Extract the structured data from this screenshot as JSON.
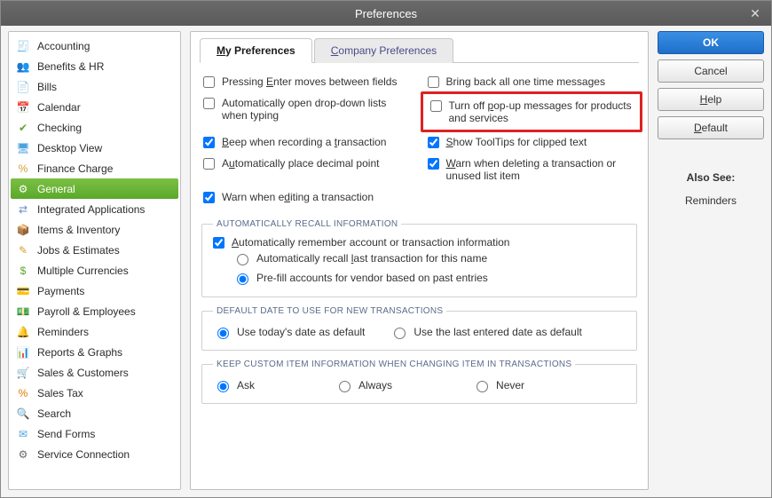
{
  "window": {
    "title": "Preferences"
  },
  "sidebar": {
    "items": [
      {
        "label": "Accounting",
        "icon": "🧾",
        "color": "#d0a030"
      },
      {
        "label": "Benefits & HR",
        "icon": "👥",
        "color": "#4aa3df"
      },
      {
        "label": "Bills",
        "icon": "📄",
        "color": "#5aa82b"
      },
      {
        "label": "Calendar",
        "icon": "📅",
        "color": "#d0a030"
      },
      {
        "label": "Checking",
        "icon": "✔",
        "color": "#5aa82b"
      },
      {
        "label": "Desktop View",
        "icon": "🖥",
        "color": "#4aa3df"
      },
      {
        "label": "Finance Charge",
        "icon": "%",
        "color": "#d0a030"
      },
      {
        "label": "General",
        "icon": "⚙",
        "color": "#ffffff",
        "selected": true
      },
      {
        "label": "Integrated Applications",
        "icon": "⇄",
        "color": "#6a8ac0"
      },
      {
        "label": "Items & Inventory",
        "icon": "📦",
        "color": "#d0a030"
      },
      {
        "label": "Jobs & Estimates",
        "icon": "✎",
        "color": "#d0a030"
      },
      {
        "label": "Multiple Currencies",
        "icon": "$",
        "color": "#5aa82b"
      },
      {
        "label": "Payments",
        "icon": "💳",
        "color": "#4aa3df"
      },
      {
        "label": "Payroll & Employees",
        "icon": "💵",
        "color": "#5aa82b"
      },
      {
        "label": "Reminders",
        "icon": "🔔",
        "color": "#d0a030"
      },
      {
        "label": "Reports & Graphs",
        "icon": "📊",
        "color": "#c0504d"
      },
      {
        "label": "Sales & Customers",
        "icon": "🛒",
        "color": "#d0a030"
      },
      {
        "label": "Sales Tax",
        "icon": "%",
        "color": "#e07b00"
      },
      {
        "label": "Search",
        "icon": "🔍",
        "color": "#6a6a6a"
      },
      {
        "label": "Send Forms",
        "icon": "✉",
        "color": "#4aa3df"
      },
      {
        "label": "Service Connection",
        "icon": "⚙",
        "color": "#6a6a6a"
      }
    ]
  },
  "tabs": {
    "my": "My Preferences",
    "company": "Company Preferences"
  },
  "options": {
    "left": [
      {
        "key": "enter_moves",
        "checked": false,
        "html": "Pressing <u>E</u>nter moves between fields"
      },
      {
        "key": "auto_dropdown",
        "checked": false,
        "html": "Automatically open drop-down lists when typing"
      },
      {
        "key": "beep",
        "checked": true,
        "html": "<u>B</u>eep when recording a <u>t</u>ransaction"
      },
      {
        "key": "auto_decimal",
        "checked": false,
        "html": "A<u>u</u>tomatically place decimal point"
      },
      {
        "key": "warn_edit",
        "checked": true,
        "html": "Warn when e<u>d</u>iting a transaction"
      }
    ],
    "right": [
      {
        "key": "bring_back",
        "checked": false,
        "html": "Brin<u>g</u> back all one time messages"
      },
      {
        "key": "turn_off_popup",
        "checked": false,
        "html": "Turn off <u>p</u>op-up messages for products and services",
        "highlight": true
      },
      {
        "key": "tooltips",
        "checked": true,
        "html": "<u>S</u>how ToolTips for clipped text"
      },
      {
        "key": "warn_delete",
        "checked": true,
        "html": "<u>W</u>arn when deleting a transaction or unused list item"
      }
    ]
  },
  "recall": {
    "legend": "AUTOMATICALLY RECALL INFORMATION",
    "remember": {
      "checked": true,
      "html": "<u>A</u>utomatically remember account or transaction information"
    },
    "sub": [
      {
        "value": "last",
        "checked": false,
        "html": "Automatically recall <u>l</u>ast transaction for this name"
      },
      {
        "value": "prefill",
        "checked": true,
        "html": "Pre-fill accounts for vendor based on past entries"
      }
    ]
  },
  "defaultDate": {
    "legend": "DEFAULT DATE TO USE FOR NEW TRANSACTIONS",
    "opts": [
      {
        "value": "today",
        "checked": true,
        "label": "Use today's date as default"
      },
      {
        "value": "last",
        "checked": false,
        "label": "Use the last entered date as default"
      }
    ]
  },
  "keepCustom": {
    "legend": "KEEP CUSTOM ITEM INFORMATION WHEN CHANGING ITEM IN TRANSACTIONS",
    "opts": [
      {
        "value": "ask",
        "checked": true,
        "label": "Ask"
      },
      {
        "value": "always",
        "checked": false,
        "label": "Always"
      },
      {
        "value": "never",
        "checked": false,
        "label": "Never"
      }
    ]
  },
  "buttons": {
    "ok": "OK",
    "cancel": "Cancel",
    "help": "Help",
    "default": "Default"
  },
  "alsoSee": {
    "heading": "Also See:",
    "items": [
      "Reminders"
    ]
  }
}
